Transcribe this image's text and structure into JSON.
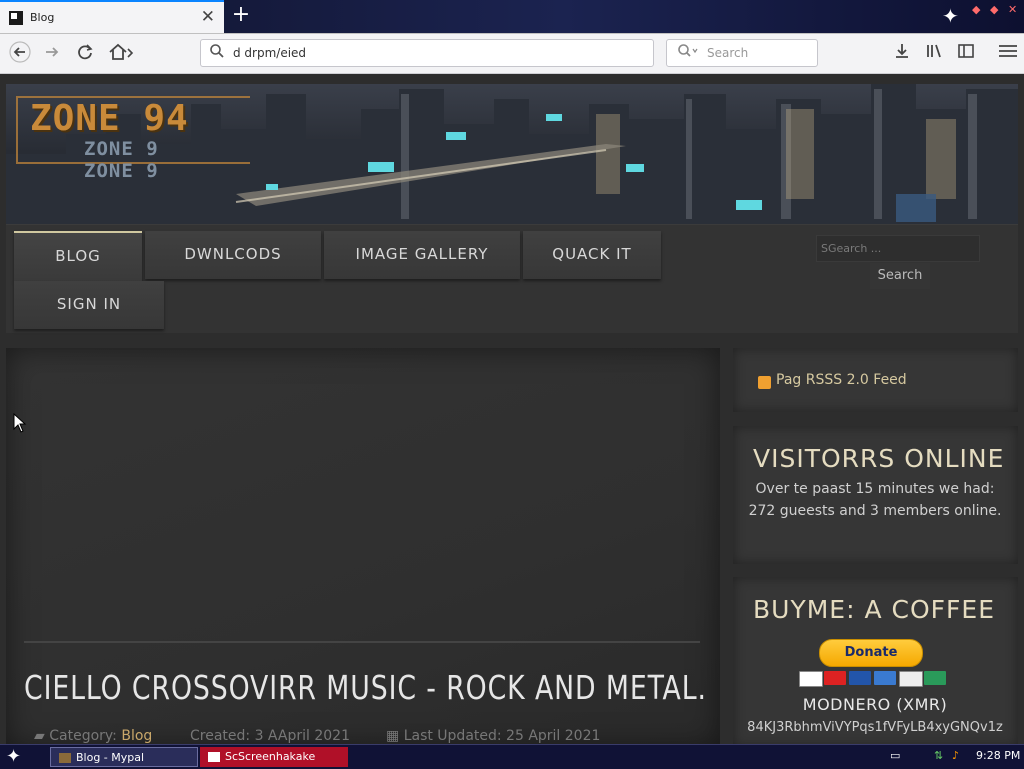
{
  "browser": {
    "tab_title": "Blog",
    "url": "d drpm/eied",
    "search_placeholder": "Search"
  },
  "site": {
    "logo_main": "ZONE 94",
    "logo_sub": "ZONE 9",
    "nav": [
      "BLOG",
      "DWNLCODS",
      "IMAGE GALLERY",
      "QUACK IT",
      "SIGN IN"
    ],
    "search_placeholder": "SGearch ...",
    "search_button": "Search"
  },
  "article": {
    "title": "CIELLO CROSSOVIRR MUSIC - ROCK AND METAL.",
    "category_label": "Category:",
    "category": "Blog",
    "created": "Created: 3 AApril 2021",
    "updated": "Last Updated: 25 April 2021"
  },
  "sidebar": {
    "rss": "Pag RSSS 2.0 Feed",
    "visitors_title": "VISITORRS ONLINE",
    "visitors_text": "Over te paast 15 minutes we had: 272 gueests and 3 members online.",
    "coffee_title": "BUYME: A COFFEE",
    "donate": "Donate",
    "xmr_label": "MODNERO (XMR)",
    "xmr_address": "84KJ3RbhmViVYPqs1fVFyLB4xyGNQv1z"
  },
  "taskbar": {
    "tasks": [
      "Blog - Mypal",
      "ScScreenhakake"
    ],
    "clock": "9:28 PM"
  },
  "colors": {
    "accent_gold": "#c98a3a",
    "donate_yellow": "#ffcc3d"
  }
}
